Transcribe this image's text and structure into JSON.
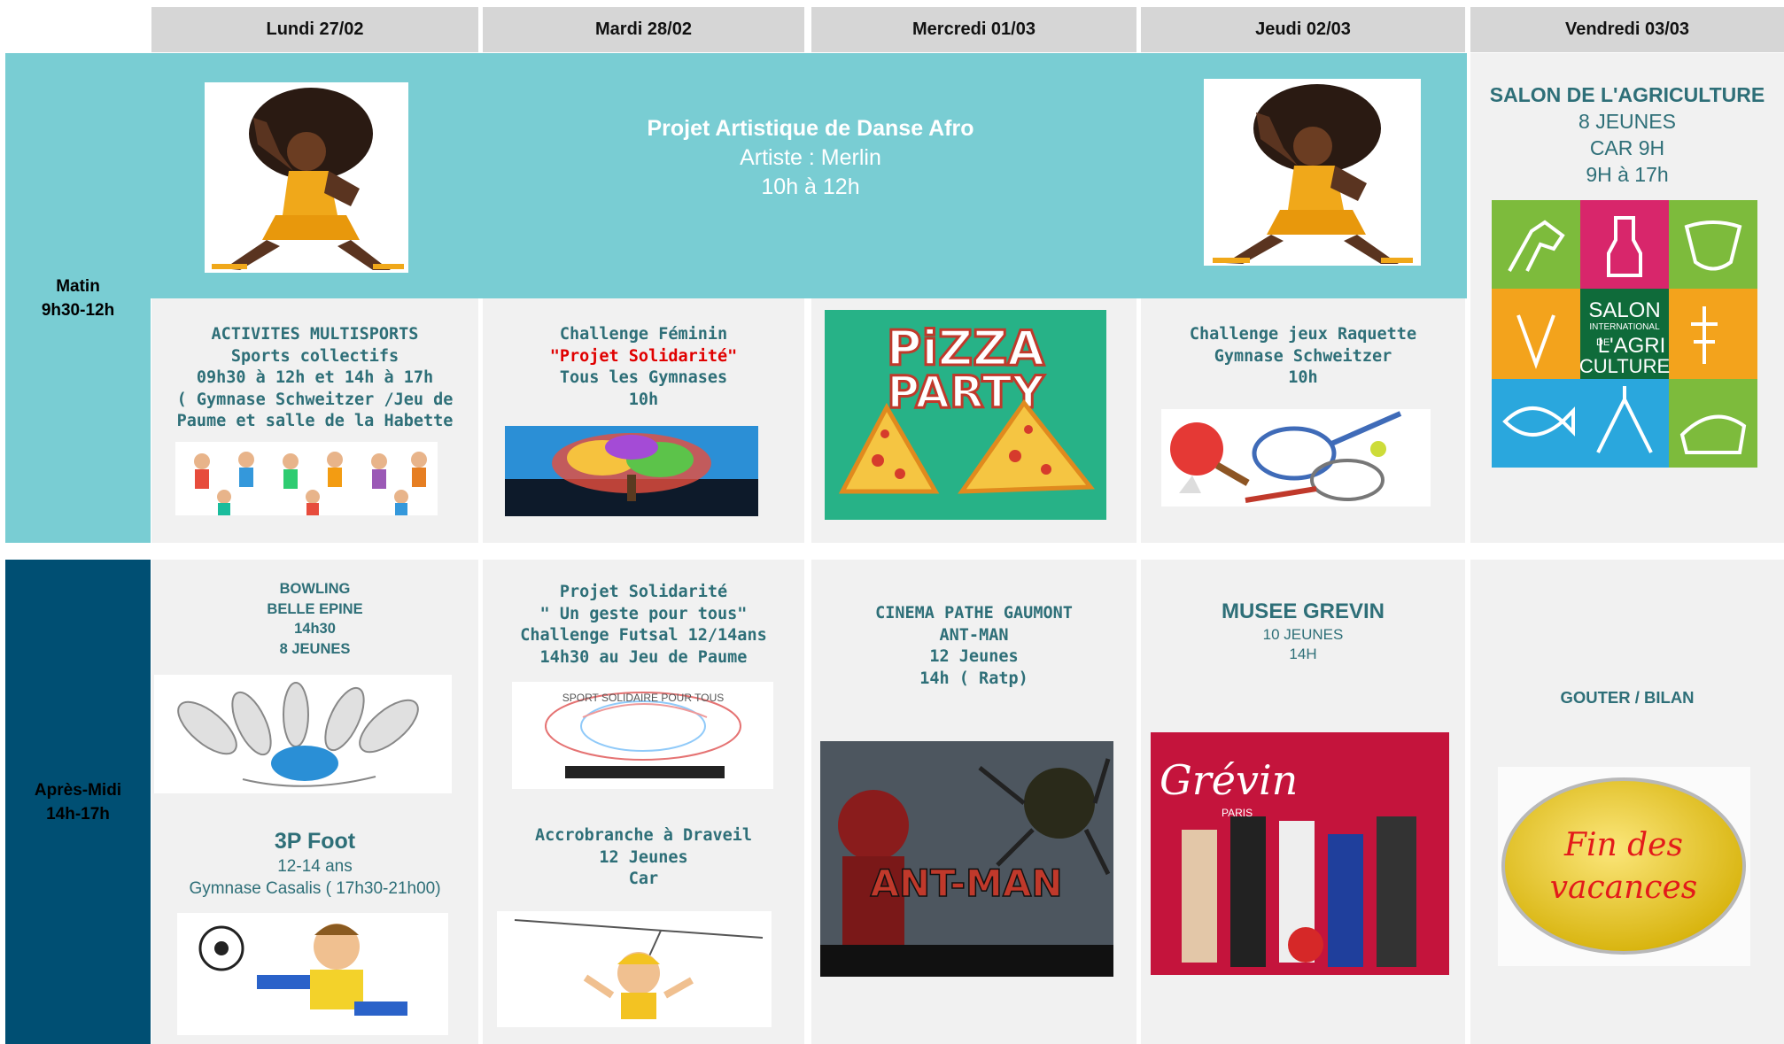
{
  "headers": [
    "Lundi 27/02",
    "Mardi 28/02",
    "Mercredi 01/03",
    "Jeudi 02/03",
    "Vendredi 03/03"
  ],
  "rows": {
    "morning": [
      "Matin",
      "9h30-12h"
    ],
    "afternoon": [
      "Après-Midi",
      "14h-17h"
    ]
  },
  "colors": {
    "teal": "#79cdd3",
    "navy": "#004f73",
    "header": "#d6d6d6",
    "cell": "#f1f1f1",
    "text_teal": "#2e6f78"
  },
  "afro": {
    "title": "Projet Artistique de Danse Afro",
    "artist": "Artiste : Merlin",
    "time": "10h à 12h"
  },
  "salon": {
    "lines": [
      "SALON DE L'AGRICULTURE",
      "8 JEUNES",
      "CAR 9H",
      "9H à 17h"
    ],
    "logo": [
      "SALON",
      "INTERNATIONAL",
      "DE",
      "L'AGRI",
      "CULTURE"
    ]
  },
  "multisports": [
    "ACTIVITES MULTISPORTS",
    "Sports collectifs",
    "09h30  à 12h et 14h à 17h",
    "( Gymnase Schweitzer /Jeu de",
    "Paume et salle de la Habette"
  ],
  "feminin": [
    "Challenge Féminin",
    "\"Projet Solidarité\"",
    "Tous les Gymnases",
    "10h"
  ],
  "pizza": [
    "PiZZA",
    "PARTY"
  ],
  "raquette": [
    "Challenge jeux  Raquette",
    "Gymnase Schweitzer",
    "10h"
  ],
  "bowling": [
    "BOWLING",
    "BELLE EPINE",
    "14h30",
    "8 JEUNES"
  ],
  "foot": {
    "title": "3P Foot",
    "lines": [
      "12-14 ans",
      "Gymnase Casalis  ( 17h30-21h00)"
    ]
  },
  "solidarite": [
    "Projet Solidarité",
    "\" Un geste pour tous\"",
    "Challenge Futsal 12/14ans",
    "14h30 au Jeu de Paume"
  ],
  "accrobranche": [
    "Accrobranche à Draveil",
    "12 Jeunes",
    "Car"
  ],
  "cinema": [
    "CINEMA PATHE GAUMONT",
    "ANT-MAN",
    "12 Jeunes",
    "14h ( Ratp)"
  ],
  "antman_logo": "ANT-MAN",
  "grevin": {
    "title": "MUSEE GREVIN",
    "lines": [
      "10 JEUNES",
      "14H"
    ],
    "logo": "Grévin",
    "logo_sub": "PARIS"
  },
  "gouter": "GOUTER /  BILAN",
  "fin": [
    "Fin des",
    "vacances"
  ],
  "solidaire_banner": "SPORT SOLIDAIRE POUR TOUS"
}
